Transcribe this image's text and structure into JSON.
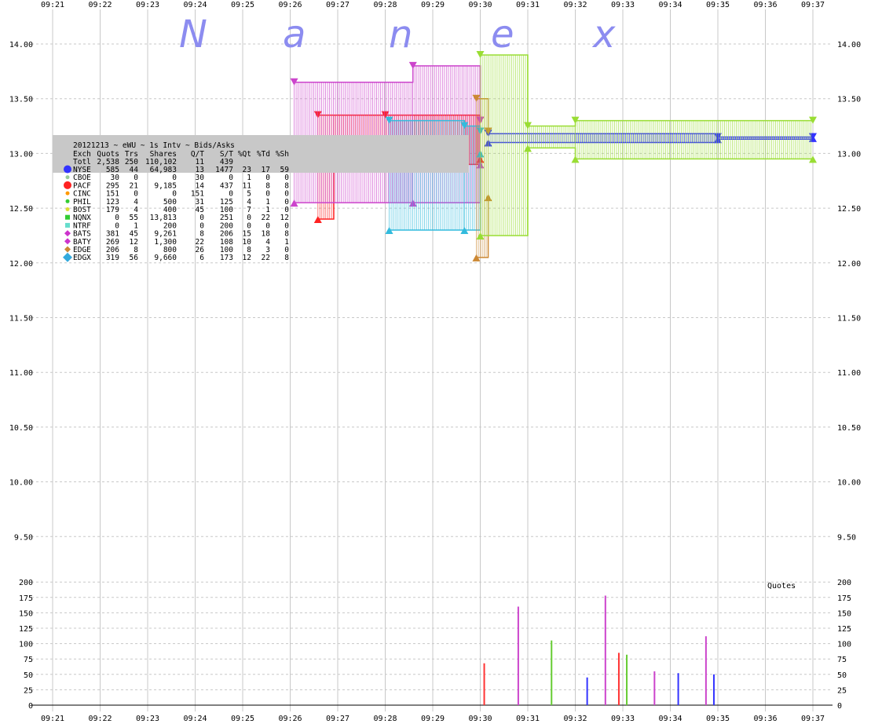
{
  "watermark": [
    "N",
    "a",
    "n",
    "e",
    "x"
  ],
  "chart_data": {
    "type": "line",
    "title": "20121213 ~ eWU ~ 1s Intv ~ Bids/Asks",
    "x_ticks": [
      "09:21",
      "09:22",
      "09:23",
      "09:24",
      "09:25",
      "09:26",
      "09:27",
      "09:28",
      "09:29",
      "09:30",
      "09:31",
      "09:32",
      "09:33",
      "09:34",
      "09:35",
      "09:36",
      "09:37"
    ],
    "price_ticks": [
      "14.00",
      "13.50",
      "13.00",
      "12.50",
      "12.00",
      "11.50",
      "11.00",
      "10.50",
      "10.00",
      "9.50"
    ],
    "price_ylim": [
      9.25,
      14.2
    ],
    "grid": true,
    "volume_panel": {
      "label": "Quotes",
      "y_ticks": [
        "200",
        "175",
        "150",
        "125",
        "100",
        "75",
        "50",
        "25",
        "0"
      ],
      "ylim": [
        0,
        200
      ],
      "spikes": [
        {
          "t": "09:30:05",
          "v": 68,
          "color": "#ff3333"
        },
        {
          "t": "09:30:48",
          "v": 160,
          "color": "#cc44cc"
        },
        {
          "t": "09:31:30",
          "v": 105,
          "color": "#66cc33"
        },
        {
          "t": "09:32:15",
          "v": 45,
          "color": "#3333ff"
        },
        {
          "t": "09:32:38",
          "v": 178,
          "color": "#cc44cc"
        },
        {
          "t": "09:32:55",
          "v": 85,
          "color": "#ff3333"
        },
        {
          "t": "09:33:05",
          "v": 82,
          "color": "#66cc33"
        },
        {
          "t": "09:33:40",
          "v": 55,
          "color": "#cc44cc"
        },
        {
          "t": "09:34:10",
          "v": 52,
          "color": "#3333ff"
        },
        {
          "t": "09:34:45",
          "v": 112,
          "color": "#cc44cc"
        },
        {
          "t": "09:34:55",
          "v": 50,
          "color": "#3333ff"
        }
      ]
    },
    "series": [
      {
        "name": "NYSE",
        "color": "#3333ff",
        "bid": [
          {
            "t": "09:30:10",
            "v": 13.1
          },
          {
            "t": "09:35:00",
            "v": 13.13
          },
          {
            "t": "09:37:00",
            "v": 13.14
          }
        ],
        "ask": [
          {
            "t": "09:30:10",
            "v": 13.18
          },
          {
            "t": "09:35:00",
            "v": 13.15
          },
          {
            "t": "09:37:00",
            "v": 13.15
          }
        ]
      },
      {
        "name": "PACF",
        "color": "#ff2222",
        "bid": [
          {
            "t": "09:26:35",
            "v": 12.4
          },
          {
            "t": "09:26:55",
            "v": 12.9
          },
          {
            "t": "09:30:00",
            "v": 12.95
          }
        ],
        "ask": [
          {
            "t": "09:26:35",
            "v": 13.35
          },
          {
            "t": "09:28:00",
            "v": 13.35
          },
          {
            "t": "09:30:00",
            "v": 13.3
          }
        ]
      },
      {
        "name": "BATS",
        "color": "#cc44cc",
        "bid": [
          {
            "t": "09:26:05",
            "v": 12.55
          },
          {
            "t": "09:28:35",
            "v": 12.55
          },
          {
            "t": "09:30:00",
            "v": 12.9
          }
        ],
        "ask": [
          {
            "t": "09:26:05",
            "v": 13.65
          },
          {
            "t": "09:28:35",
            "v": 13.8
          },
          {
            "t": "09:30:00",
            "v": 13.3
          }
        ]
      },
      {
        "name": "EDGX",
        "color": "#33bbdd",
        "bid": [
          {
            "t": "09:28:05",
            "v": 12.3
          },
          {
            "t": "09:29:40",
            "v": 12.3
          },
          {
            "t": "09:30:00",
            "v": 13.0
          }
        ],
        "ask": [
          {
            "t": "09:28:05",
            "v": 13.3
          },
          {
            "t": "09:29:40",
            "v": 13.25
          },
          {
            "t": "09:30:00",
            "v": 13.2
          }
        ]
      },
      {
        "name": "EDGE",
        "color": "#cc8833",
        "bid": [
          {
            "t": "09:29:55",
            "v": 12.05
          },
          {
            "t": "09:30:10",
            "v": 12.6
          }
        ],
        "ask": [
          {
            "t": "09:29:55",
            "v": 13.5
          },
          {
            "t": "09:30:10",
            "v": 13.2
          }
        ]
      },
      {
        "name": "NQNX",
        "color": "#99dd33",
        "bid": [
          {
            "t": "09:30:00",
            "v": 12.25
          },
          {
            "t": "09:31:00",
            "v": 13.05
          },
          {
            "t": "09:32:00",
            "v": 12.95
          },
          {
            "t": "09:37:00",
            "v": 12.95
          }
        ],
        "ask": [
          {
            "t": "09:30:00",
            "v": 13.9
          },
          {
            "t": "09:31:00",
            "v": 13.25
          },
          {
            "t": "09:32:00",
            "v": 13.3
          },
          {
            "t": "09:37:00",
            "v": 13.3
          }
        ]
      }
    ],
    "table": {
      "header": [
        "Exch",
        "Quots",
        "Trs",
        "Shares",
        "Q/T",
        "S/T",
        "%Qt",
        "%Td",
        "%Sh"
      ],
      "total": [
        "Totl",
        "2,538",
        "250",
        "110,102",
        "11",
        "439",
        "",
        "",
        ""
      ],
      "rows": [
        {
          "exch": "NYSE",
          "color": "#3333ff",
          "marker": "circle-large",
          "values": [
            "585",
            "44",
            "64,983",
            "13",
            "1477",
            "23",
            "17",
            "59"
          ]
        },
        {
          "exch": "CBOE",
          "color": "#99cc99",
          "marker": "circle",
          "values": [
            "30",
            "0",
            "0",
            "30",
            "0",
            "1",
            "0",
            "0"
          ]
        },
        {
          "exch": "PACF",
          "color": "#ff2222",
          "marker": "circle-large",
          "values": [
            "295",
            "21",
            "9,185",
            "14",
            "437",
            "11",
            "8",
            "8"
          ]
        },
        {
          "exch": "CINC",
          "color": "#ff9900",
          "marker": "circle",
          "values": [
            "151",
            "0",
            "0",
            "151",
            "0",
            "5",
            "0",
            "0"
          ]
        },
        {
          "exch": "PHIL",
          "color": "#33cc33",
          "marker": "circle",
          "values": [
            "123",
            "4",
            "500",
            "31",
            "125",
            "4",
            "1",
            "0"
          ]
        },
        {
          "exch": "BOST",
          "color": "#dddd33",
          "marker": "circle",
          "values": [
            "179",
            "4",
            "400",
            "45",
            "100",
            "7",
            "1",
            "0"
          ]
        },
        {
          "exch": "NQNX",
          "color": "#33cc33",
          "marker": "square",
          "values": [
            "0",
            "55",
            "13,813",
            "0",
            "251",
            "0",
            "22",
            "12"
          ]
        },
        {
          "exch": "NTRF",
          "color": "#66ddcc",
          "marker": "square",
          "values": [
            "0",
            "1",
            "200",
            "0",
            "200",
            "0",
            "0",
            "0"
          ]
        },
        {
          "exch": "BATS",
          "color": "#cc33cc",
          "marker": "diamond",
          "values": [
            "381",
            "45",
            "9,261",
            "8",
            "206",
            "15",
            "18",
            "8"
          ]
        },
        {
          "exch": "BATY",
          "color": "#cc33cc",
          "marker": "diamond",
          "values": [
            "269",
            "12",
            "1,300",
            "22",
            "108",
            "10",
            "4",
            "1"
          ]
        },
        {
          "exch": "EDGE",
          "color": "#cc8833",
          "marker": "diamond",
          "values": [
            "206",
            "8",
            "800",
            "26",
            "100",
            "8",
            "3",
            "0"
          ]
        },
        {
          "exch": "EDGX",
          "color": "#33aadd",
          "marker": "diamond-large",
          "values": [
            "319",
            "56",
            "9,660",
            "6",
            "173",
            "12",
            "22",
            "8"
          ]
        }
      ]
    }
  }
}
